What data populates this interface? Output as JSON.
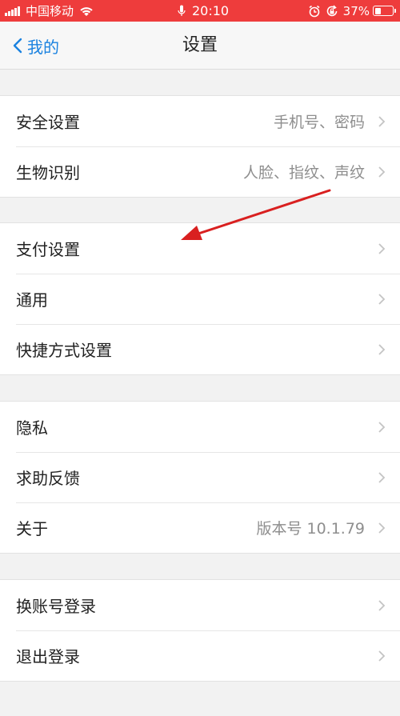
{
  "status_bar": {
    "carrier": "中国移动",
    "time": "20:10",
    "battery": "37%",
    "battery_level": 0.37,
    "icons": [
      "signal-icon",
      "wifi-icon",
      "mic-icon",
      "alarm-icon",
      "rotation-lock-icon",
      "battery-icon"
    ]
  },
  "nav": {
    "back_label": "我的",
    "title": "设置"
  },
  "groups": [
    {
      "items": [
        {
          "label": "安全设置",
          "value": "手机号、密码"
        },
        {
          "label": "生物识别",
          "value": "人脸、指纹、声纹"
        }
      ]
    },
    {
      "items": [
        {
          "label": "支付设置",
          "value": ""
        },
        {
          "label": "通用",
          "value": ""
        },
        {
          "label": "快捷方式设置",
          "value": ""
        }
      ]
    },
    {
      "items": [
        {
          "label": "隐私",
          "value": ""
        },
        {
          "label": "求助反馈",
          "value": ""
        },
        {
          "label": "关于",
          "value": "版本号 10.1.79"
        }
      ]
    },
    {
      "items": [
        {
          "label": "换账号登录",
          "value": ""
        },
        {
          "label": "退出登录",
          "value": ""
        }
      ]
    }
  ],
  "colors": {
    "status_bar": "#ee3c3c",
    "accent": "#1a82e0",
    "annotation_arrow": "#d92020"
  },
  "annotation": {
    "type": "arrow",
    "points_to": "支付设置"
  }
}
